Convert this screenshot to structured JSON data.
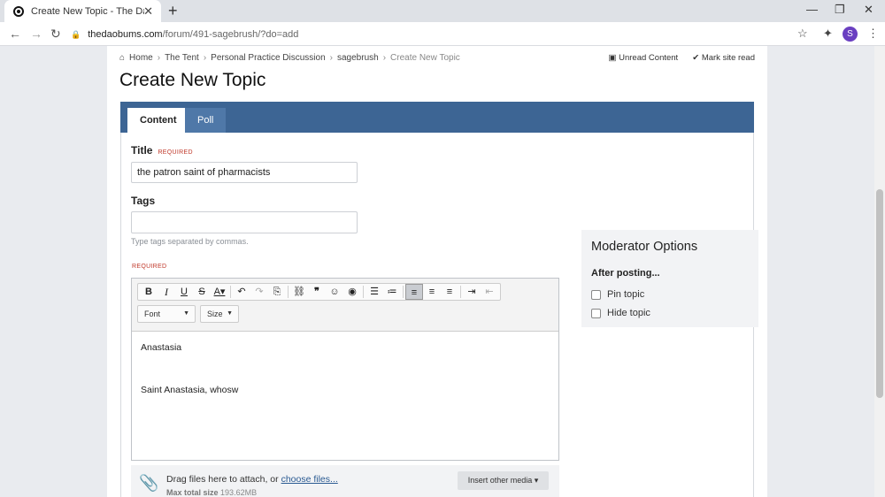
{
  "browser": {
    "tab_title": "Create New Topic - The Dao Bum",
    "url_host": "thedaobums.com",
    "url_path": "/forum/491-sagebrush/?do=add",
    "profile_initial": "S"
  },
  "header": {
    "breadcrumb": [
      {
        "label": "Home"
      },
      {
        "label": "The Tent"
      },
      {
        "label": "Personal Practice Discussion"
      },
      {
        "label": "sagebrush"
      },
      {
        "label": "Create New Topic"
      }
    ],
    "unread_content": "Unread Content",
    "mark_site_read": "Mark site read",
    "page_title": "Create New Topic"
  },
  "tabs": {
    "content": "Content",
    "poll": "Poll"
  },
  "form": {
    "title_label": "Title",
    "required": "REQUIRED",
    "title_value": "the patron saint of pharmacists",
    "tags_label": "Tags",
    "tags_value": "",
    "tags_hint": "Type tags separated by commas.",
    "font_dropdown": "Font",
    "size_dropdown": "Size",
    "body_lines": [
      "Anastasia",
      "",
      "Saint Anastasia, whosw"
    ],
    "attach_text": "Drag files here to attach, or ",
    "attach_link": "choose files...",
    "max_label": "Max total size",
    "max_value": "193.62MB",
    "insert_media": "Insert other media"
  },
  "moderator": {
    "heading": "Moderator Options",
    "after_posting": "After posting...",
    "pin_topic": "Pin topic",
    "hide_topic": "Hide topic"
  }
}
